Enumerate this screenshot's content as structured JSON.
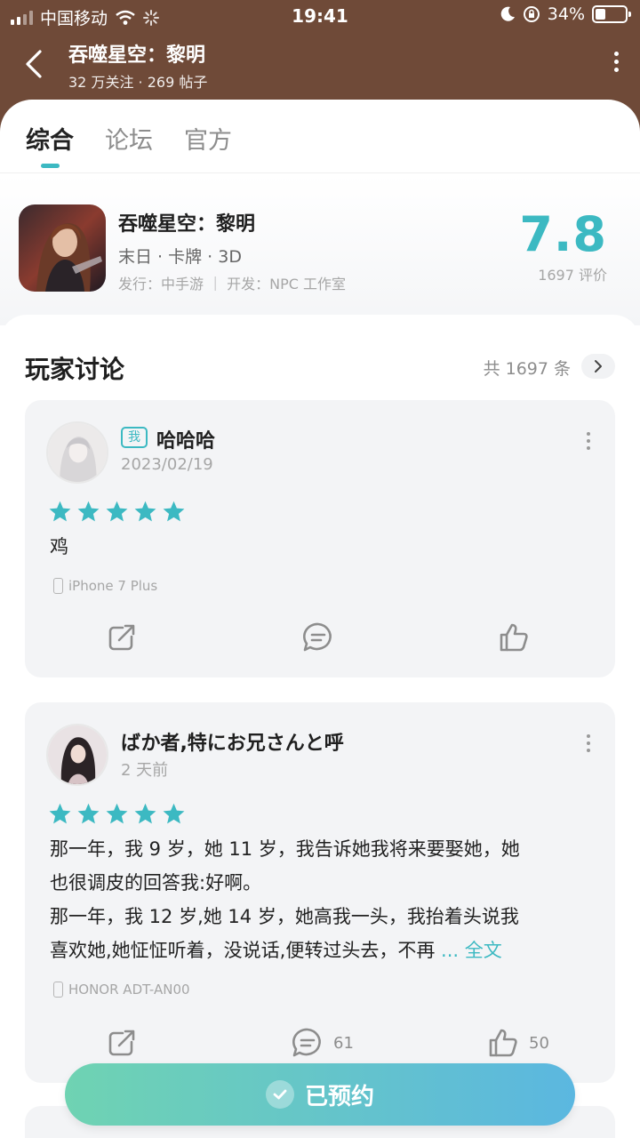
{
  "status_bar": {
    "carrier": "中国移动",
    "time": "19:41",
    "battery": "34%"
  },
  "nav": {
    "title": "吞噬星空：黎明",
    "subtitle": "32 万关注 · 269 帖子"
  },
  "tabs": [
    {
      "label": "综合",
      "active": true
    },
    {
      "label": "论坛",
      "active": false
    },
    {
      "label": "官方",
      "active": false
    }
  ],
  "game": {
    "name": "吞噬星空：黎明",
    "tags": "末日 · 卡牌 · 3D",
    "publisher_line": "发行：中手游 ｜ 开发：NPC 工作室",
    "score": "7.8",
    "rating_count": "1697 评价"
  },
  "discussion": {
    "title": "玩家讨论",
    "count": "共 1697 条",
    "posts": [
      {
        "me_badge": "我",
        "user": "哈哈哈",
        "date": "2023/02/19",
        "stars": 5,
        "text": "鸡",
        "device": "iPhone 7 Plus",
        "comments": "",
        "likes": ""
      },
      {
        "user": "ばか者,特にお兄さんと呼",
        "date": "2 天前",
        "stars": 5,
        "text_lines": [
          "那一年，我 9 岁，她 11 岁，我告诉她我将来要娶她，她",
          "也很调皮的回答我:好啊。",
          "那一年，我 12 岁,她 14 岁，她高我一头，我抬着头说我",
          "喜欢她,她怔怔听着，没说话,便转过头去，不再"
        ],
        "more_label": "... 全文",
        "device": "HONOR ADT-AN00",
        "comments": "61",
        "likes": "50"
      }
    ]
  },
  "reserve_button": {
    "label": "已预约"
  },
  "colors": {
    "header_brown": "#6f4a38",
    "accent": "#3cb9c2",
    "card_bg": "#f3f4f6"
  }
}
